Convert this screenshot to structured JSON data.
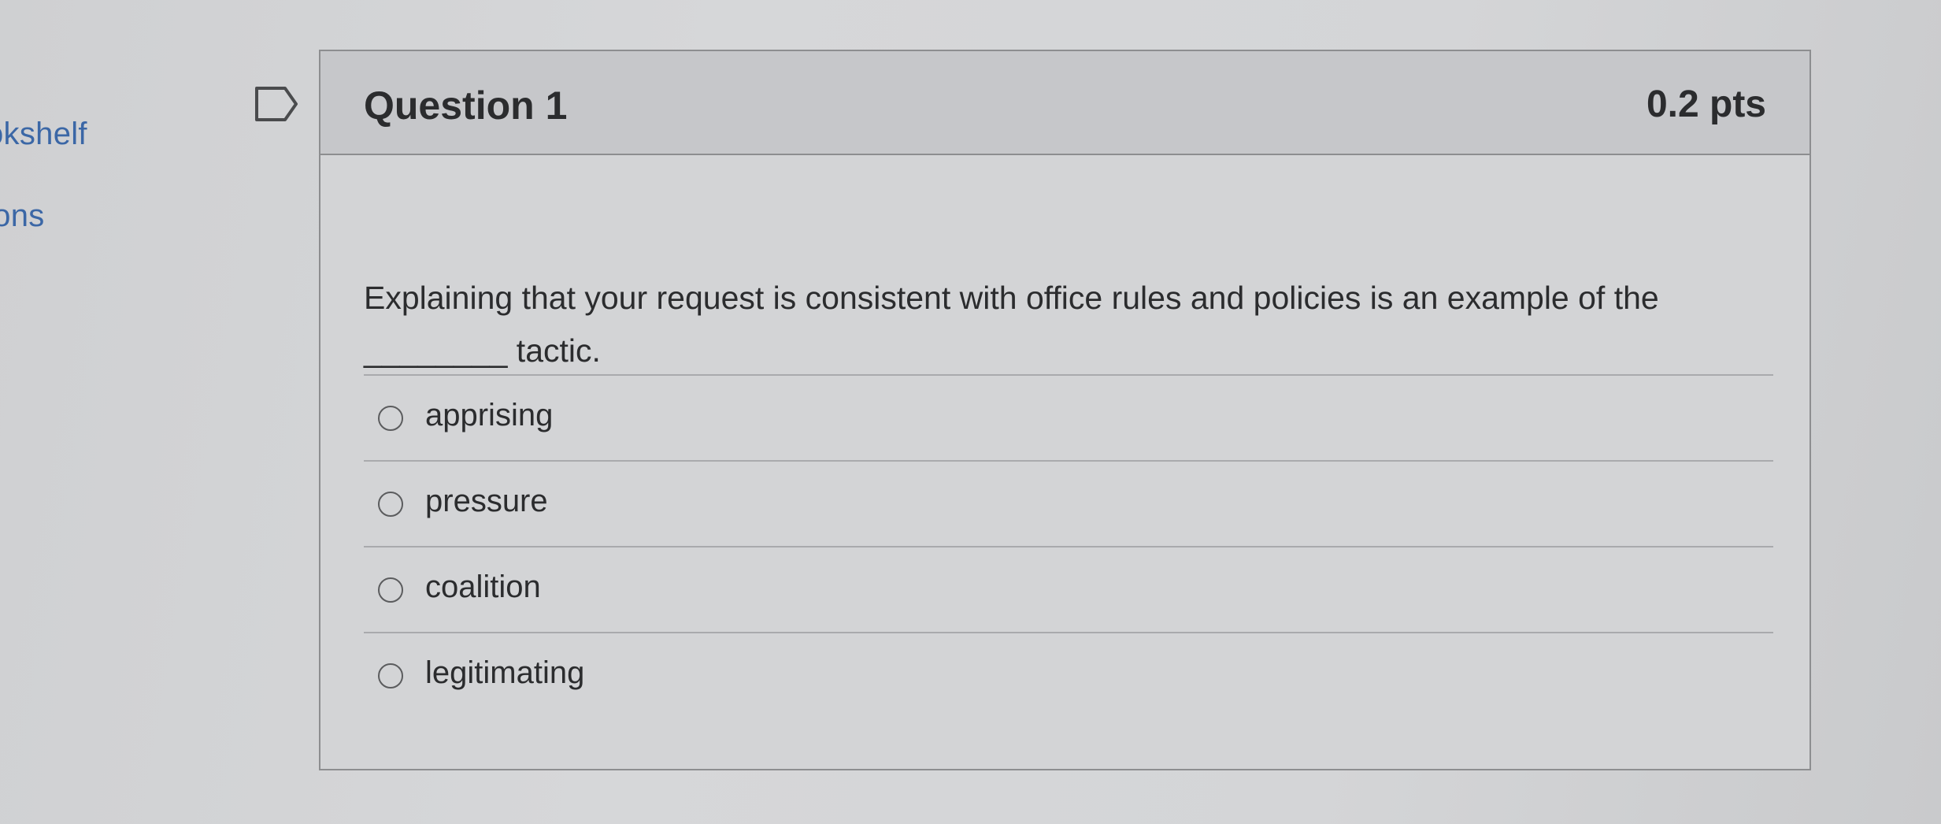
{
  "sidebar": {
    "items": [
      {
        "label": "okshelf"
      },
      {
        "label": "ions"
      }
    ]
  },
  "question": {
    "title": "Question 1",
    "points": "0.2 pts",
    "text_line1": "Explaining that your request is consistent with office rules and policies is an example of the",
    "text_line2": "________ tactic.",
    "answers": [
      {
        "label": "apprising"
      },
      {
        "label": "pressure"
      },
      {
        "label": "coalition"
      },
      {
        "label": "legitimating"
      }
    ]
  },
  "icons": {
    "bookmark": "bookmark-flag-icon"
  },
  "colors": {
    "link": "#3b67a6",
    "text": "#2b2c2e",
    "border": "#8d8e90"
  }
}
